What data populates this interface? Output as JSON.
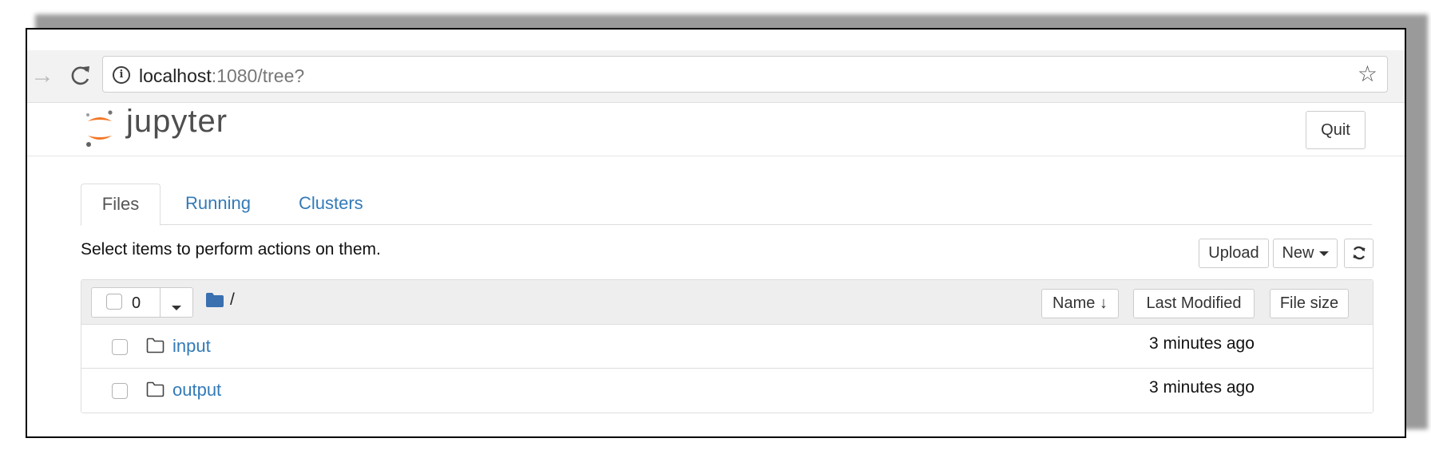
{
  "browser": {
    "url_host": "localhost",
    "url_rest": ":1080/tree?",
    "forward_glyph": "→",
    "star_glyph": "☆",
    "info_glyph": "i"
  },
  "header": {
    "logo_text": "jupyter",
    "quit_label": "Quit"
  },
  "tabs": [
    {
      "label": "Files",
      "active": true
    },
    {
      "label": "Running",
      "active": false
    },
    {
      "label": "Clusters",
      "active": false
    }
  ],
  "toolbar": {
    "hint": "Select items to perform actions on them.",
    "upload_label": "Upload",
    "new_label": "New",
    "refresh_glyph": "⟳"
  },
  "list": {
    "selected_count": "0",
    "root_path": "/",
    "columns": {
      "name": "Name ↓",
      "last_modified": "Last Modified",
      "file_size": "File size"
    },
    "rows": [
      {
        "name": "input",
        "modified": "3 minutes ago",
        "type": "folder"
      },
      {
        "name": "output",
        "modified": "3 minutes ago",
        "type": "folder"
      }
    ]
  },
  "colors": {
    "link": "#337ab7",
    "jupyter_orange": "#f37726",
    "folder_blue": "#3a6fb0"
  },
  "icons": [
    "arrow-forward-icon",
    "reload-icon",
    "info-icon",
    "star-icon",
    "jupyter-logo-icon",
    "caret-down-icon",
    "refresh-icon",
    "folder-icon"
  ]
}
